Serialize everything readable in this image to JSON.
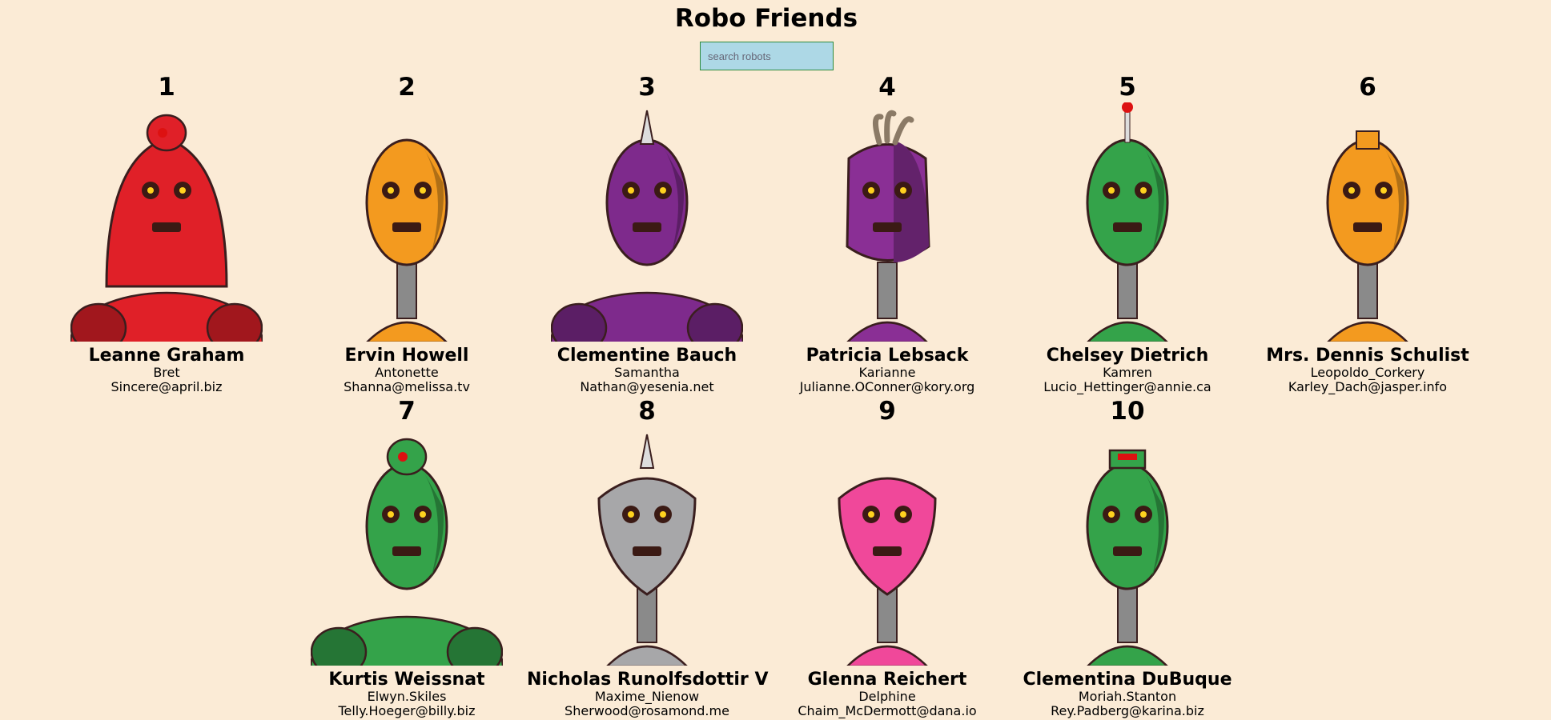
{
  "app": {
    "title": "Robo Friends"
  },
  "search": {
    "placeholder": "search robots",
    "value": ""
  },
  "robots": [
    {
      "id": "1",
      "name": "Leanne Graham",
      "username": "Bret",
      "email": "Sincere@april.biz",
      "color": "#e02028",
      "shape": "dome",
      "bodyWide": true,
      "topper": "button"
    },
    {
      "id": "2",
      "name": "Ervin Howell",
      "username": "Antonette",
      "email": "Shanna@melissa.tv",
      "color": "#f39a1f",
      "shape": "egg",
      "bodyWide": false,
      "topper": "none"
    },
    {
      "id": "3",
      "name": "Clementine Bauch",
      "username": "Samantha",
      "email": "Nathan@yesenia.net",
      "color": "#7e2a8c",
      "shape": "egg",
      "bodyWide": true,
      "topper": "spike"
    },
    {
      "id": "4",
      "name": "Patricia Lebsack",
      "username": "Karianne",
      "email": "Julianne.OConner@kory.org",
      "color": "#8a2f95",
      "shape": "box",
      "bodyWide": false,
      "topper": "wires"
    },
    {
      "id": "5",
      "name": "Chelsey Dietrich",
      "username": "Kamren",
      "email": "Lucio_Hettinger@annie.ca",
      "color": "#34a34a",
      "shape": "egg",
      "bodyWide": false,
      "topper": "antenna"
    },
    {
      "id": "6",
      "name": "Mrs. Dennis Schulist",
      "username": "Leopoldo_Corkery",
      "email": "Karley_Dach@jasper.info",
      "color": "#f39a1f",
      "shape": "egg",
      "bodyWide": false,
      "topper": "seven"
    },
    {
      "id": "7",
      "name": "Kurtis Weissnat",
      "username": "Elwyn.Skiles",
      "email": "Telly.Hoeger@billy.biz",
      "color": "#34a34a",
      "shape": "egg",
      "bodyWide": true,
      "topper": "button"
    },
    {
      "id": "8",
      "name": "Nicholas Runolfsdottir V",
      "username": "Maxime_Nienow",
      "email": "Sherwood@rosamond.me",
      "color": "#a7a7a9",
      "shape": "shield",
      "bodyWide": false,
      "topper": "spike"
    },
    {
      "id": "9",
      "name": "Glenna Reichert",
      "username": "Delphine",
      "email": "Chaim_McDermott@dana.io",
      "color": "#f0489a",
      "shape": "shield",
      "bodyWide": false,
      "topper": "none"
    },
    {
      "id": "10",
      "name": "Clementina DuBuque",
      "username": "Moriah.Stanton",
      "email": "Rey.Padberg@karina.biz",
      "color": "#34a34a",
      "shape": "egg",
      "bodyWide": false,
      "topper": "hat"
    }
  ]
}
